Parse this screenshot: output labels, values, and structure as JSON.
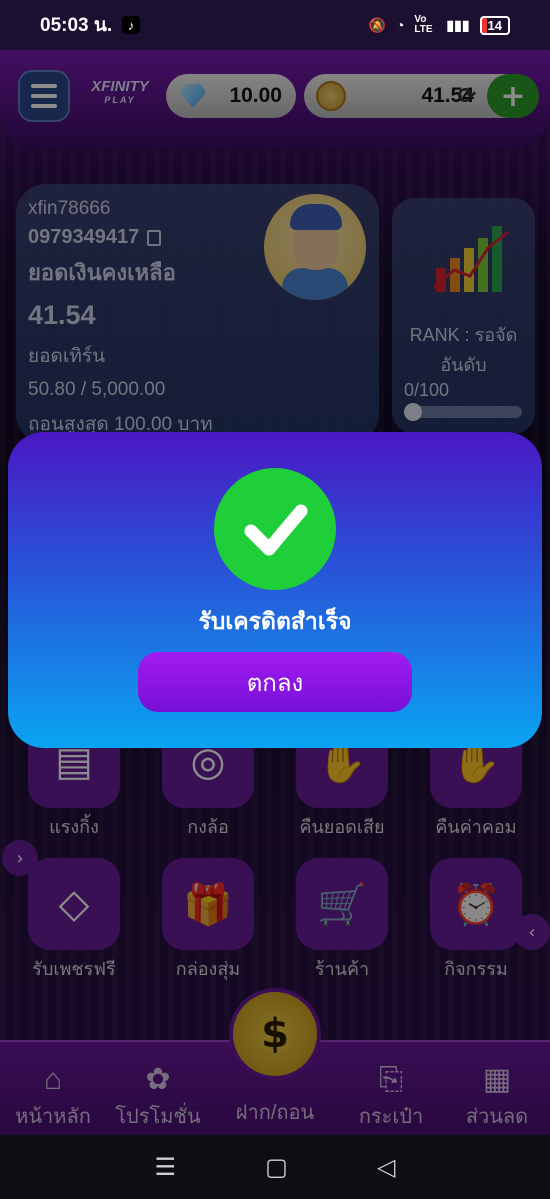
{
  "status_bar": {
    "time": "05:03 น.",
    "battery": "14",
    "network": "Vo LTE"
  },
  "header": {
    "logo_text": "XFINITY",
    "logo_sub": "PLAY",
    "gems": "10.00",
    "credit": "41.54"
  },
  "profile": {
    "username": "xfin78666",
    "phone": "0979349417",
    "balance_label": "ยอดเงินคงเหลือ",
    "balance_value": "41.54",
    "turnover_label": "ยอดเทิร์น",
    "turnover_value": "50.80 / 5,000.00",
    "max_withdraw": "ถอนสูงสุด 100.00 บาท"
  },
  "rank": {
    "label": "RANK : รอจัดอันดับ",
    "progress_text": "0/100",
    "progress": 0
  },
  "grid": {
    "row1": [
      {
        "label": "แรงกิ้ง",
        "icon": "id-card-icon"
      },
      {
        "label": "กงล้อ",
        "icon": "wheel-icon"
      },
      {
        "label": "คืนยอดเสีย",
        "icon": "hand-coin-icon"
      },
      {
        "label": "คืนค่าคอม",
        "icon": "hand-money-icon"
      }
    ],
    "row2": [
      {
        "label": "รับเพชรฟรี",
        "icon": "diamond-icon"
      },
      {
        "label": "กล่องสุ่ม",
        "icon": "gift-icon"
      },
      {
        "label": "ร้านค้า",
        "icon": "cart-icon"
      },
      {
        "label": "กิจกรรม",
        "icon": "alarm-icon"
      }
    ]
  },
  "bottom_nav": [
    {
      "label": "หน้าหลัก",
      "icon": "home-icon"
    },
    {
      "label": "โปรโมชั่น",
      "icon": "percent-badge-icon"
    },
    {
      "label": "ฝาก/ถอน",
      "icon": "dollar-refresh-icon"
    },
    {
      "label": "กระเป๋า",
      "icon": "wallet-icon"
    },
    {
      "label": "ส่วนลด",
      "icon": "coupon-icon"
    }
  ],
  "dialog": {
    "message": "รับเครดิตสำเร็จ",
    "ok_label": "ตกลง"
  },
  "colors": {
    "dialog_top": "#4a17c4",
    "dialog_bottom": "#0aa4f2",
    "success": "#1fcf3a",
    "ok_button": "#8a16e2",
    "tile": "#6b1e9b"
  }
}
